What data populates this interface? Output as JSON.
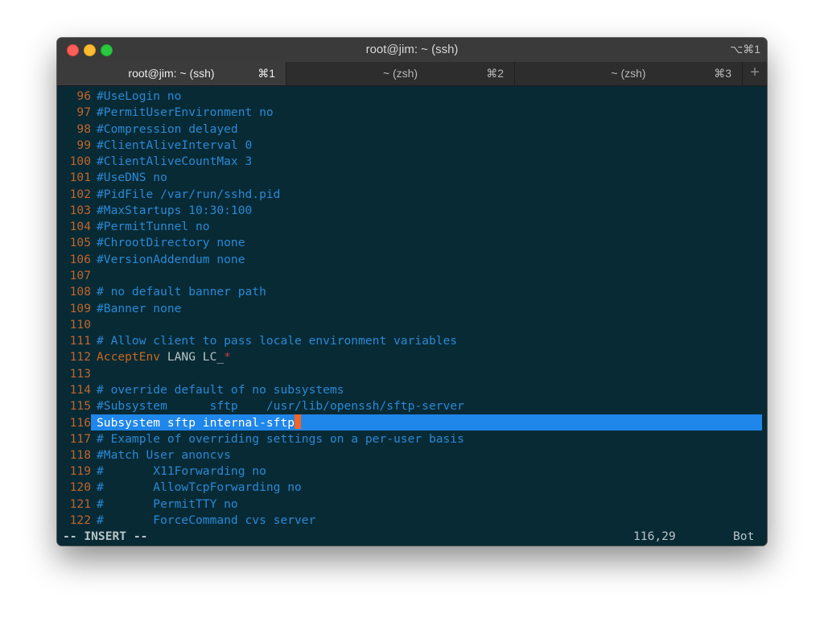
{
  "window": {
    "title": "root@jim: ~ (ssh)",
    "title_shortcut": "⌥⌘1"
  },
  "tabs": [
    {
      "label": "root@jim: ~ (ssh)",
      "shortcut": "⌘1",
      "active": true
    },
    {
      "label": "~ (zsh)",
      "shortcut": "⌘2",
      "active": false
    },
    {
      "label": "~ (zsh)",
      "shortcut": "⌘3",
      "active": false
    }
  ],
  "tab_add_label": "+",
  "editor": {
    "lines": [
      {
        "num": "96",
        "text": "#UseLogin no"
      },
      {
        "num": "97",
        "text": "#PermitUserEnvironment no"
      },
      {
        "num": "98",
        "text": "#Compression delayed"
      },
      {
        "num": "99",
        "text": "#ClientAliveInterval 0"
      },
      {
        "num": "100",
        "text": "#ClientAliveCountMax 3"
      },
      {
        "num": "101",
        "text": "#UseDNS no"
      },
      {
        "num": "102",
        "text": "#PidFile /var/run/sshd.pid"
      },
      {
        "num": "103",
        "text": "#MaxStartups 10:30:100"
      },
      {
        "num": "104",
        "text": "#PermitTunnel no"
      },
      {
        "num": "105",
        "text": "#ChrootDirectory none"
      },
      {
        "num": "106",
        "text": "#VersionAddendum none"
      },
      {
        "num": "107",
        "text": ""
      },
      {
        "num": "108",
        "text": "# no default banner path"
      },
      {
        "num": "109",
        "text": "#Banner none"
      },
      {
        "num": "110",
        "text": ""
      },
      {
        "num": "111",
        "text": "# Allow client to pass locale environment variables"
      },
      {
        "num": "112",
        "kw": "AcceptEnv",
        "rest": " LANG LC_",
        "star": "*"
      },
      {
        "num": "113",
        "text": ""
      },
      {
        "num": "114",
        "text": "# override default of no subsystems"
      },
      {
        "num": "115",
        "text": "#Subsystem      sftp    /usr/lib/openssh/sftp-server"
      },
      {
        "num": "116",
        "text": "Subsystem sftp internal-sftp"
      },
      {
        "num": "117",
        "text": "# Example of overriding settings on a per-user basis"
      },
      {
        "num": "118",
        "text": "#Match User anoncvs"
      },
      {
        "num": "119",
        "text": "#       X11Forwarding no"
      },
      {
        "num": "120",
        "text": "#       AllowTcpForwarding no"
      },
      {
        "num": "121",
        "text": "#       PermitTTY no"
      },
      {
        "num": "122",
        "text": "#       ForceCommand cvs server"
      }
    ],
    "current_line_index": 20
  },
  "status": {
    "mode": "-- INSERT --",
    "position": "116,29",
    "scroll": "Bot"
  },
  "colors": {
    "background": "#082a35",
    "line_number": "#c1652a",
    "comment": "#2a89d4",
    "highlight": "#1f86ea",
    "cursor": "#f26522"
  }
}
